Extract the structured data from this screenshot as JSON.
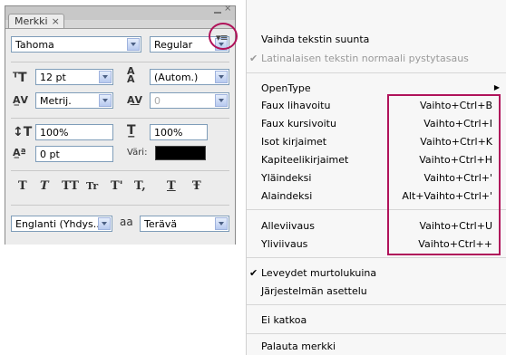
{
  "panel": {
    "tab_label": "Merkki",
    "tab_close": "×",
    "window_close": "×",
    "font_family": "Tahoma",
    "font_style": "Regular",
    "font_size": "12 pt",
    "leading": "(Autom.)",
    "kerning": "Metrij.",
    "tracking": "0",
    "vertical_scale": "100%",
    "horizontal_scale": "100%",
    "baseline_shift": "0 pt",
    "color_label": "Väri:",
    "color_value": "#000000",
    "language": "Englanti (Yhdys...",
    "anti_alias_icon_text": "aa",
    "anti_alias": "Terävä",
    "style_buttons": [
      "T",
      "T",
      "TT",
      "Tr",
      "T'",
      "T,",
      "T",
      "Ŧ"
    ],
    "menu_button_glyph": "▾≡"
  },
  "menu": {
    "items": [
      {
        "label": "Vaihda tekstin suunta",
        "shortcut": "",
        "checked": false,
        "disabled": false
      },
      {
        "label": "Latinalaisen tekstin normaali pystytasaus",
        "shortcut": "",
        "checked": true,
        "disabled": true
      },
      {
        "label": "OpenType",
        "shortcut": "",
        "submenu": true
      },
      {
        "label": "Faux lihavoitu",
        "shortcut": "Vaihto+Ctrl+B"
      },
      {
        "label": "Faux kursivoitu",
        "shortcut": "Vaihto+Ctrl+I"
      },
      {
        "label": "Isot kirjaimet",
        "shortcut": "Vaihto+Ctrl+K"
      },
      {
        "label": "Kapiteelikirjaimet",
        "shortcut": "Vaihto+Ctrl+H"
      },
      {
        "label": "Yläindeksi",
        "shortcut": "Vaihto+Ctrl+'"
      },
      {
        "label": "Alaindeksi",
        "shortcut": "Alt+Vaihto+Ctrl+'"
      },
      {
        "label": "Alleviivaus",
        "shortcut": "Vaihto+Ctrl+U"
      },
      {
        "label": "Yliviivaus",
        "shortcut": "Vaihto+Ctrl++"
      },
      {
        "label": "Leveydet murtolukuina",
        "shortcut": "",
        "checked": true
      },
      {
        "label": "Järjestelmän asettelu",
        "shortcut": ""
      },
      {
        "label": "Ei katkoa",
        "shortcut": ""
      },
      {
        "label": "Palauta merkki",
        "shortcut": ""
      }
    ],
    "checkmark": "✔",
    "submenu_arrow": "▶"
  },
  "colors": {
    "callout": "#b0135a",
    "menu_bg": "#f7f7f7",
    "panel_bg": "#ececec"
  }
}
